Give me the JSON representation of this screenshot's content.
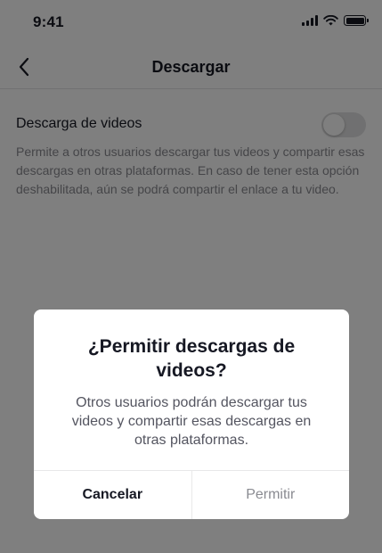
{
  "status_bar": {
    "time": "9:41"
  },
  "header": {
    "title": "Descargar",
    "back_icon": "chevron-left-icon"
  },
  "setting": {
    "label": "Descarga de videos",
    "enabled": false,
    "description": "Permite a otros usuarios descargar tus videos y compartir esas descargas en otras plataformas. En caso de tener esta opción deshabilitada, aún se podrá compartir el enlace a tu video."
  },
  "dialog": {
    "title": "¿Permitir descargas de videos?",
    "message": "Otros usuarios podrán descargar tus videos y compartir esas descargas en otras plataformas.",
    "cancel_label": "Cancelar",
    "confirm_label": "Permitir"
  }
}
